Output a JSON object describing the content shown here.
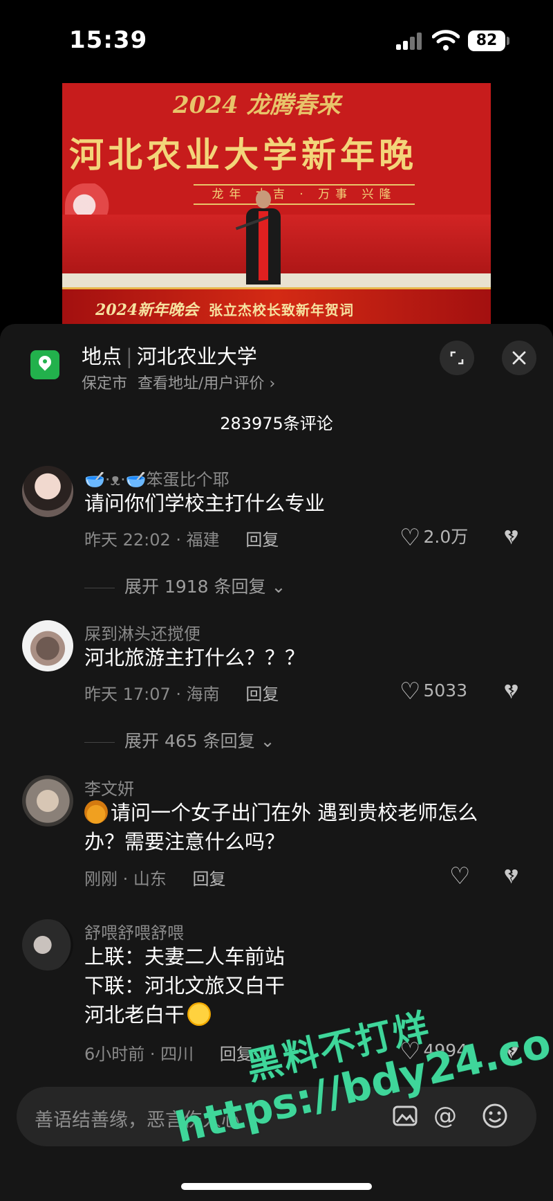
{
  "status_bar": {
    "time": "15:39",
    "battery": "82"
  },
  "video": {
    "top_gold_text": "2024 龙腾春来",
    "title": "河北农业大学新年晚",
    "sub_banner": "龙年 大吉 · 万事 兴隆",
    "caption_left": "2024新年晚会",
    "caption_right": "张立杰校长致新年贺词"
  },
  "location": {
    "label": "地点",
    "name": "河北农业大学",
    "city": "保定市",
    "link": "查看地址/用户评价",
    "chevron": "›"
  },
  "comment_count": "283975条评论",
  "comments": [
    {
      "user": "🥣·ᴥ·🥣笨蛋比个耶",
      "text": "请问你们学校主打什么专业",
      "time_place": "昨天 22:02 · 福建",
      "reply_label": "回复",
      "likes": "2.0万",
      "expand": "展开 1918 条回复"
    },
    {
      "user": "屎到淋头还搅便",
      "text": "河北旅游主打什么？？？",
      "time_place": "昨天 17:07 · 海南",
      "reply_label": "回复",
      "likes": "5033",
      "expand": "展开 465 条回复"
    },
    {
      "user": "李文妍",
      "text": "请问一个女子出门在外 遇到贵校老师怎么办？需要注意什么吗？",
      "time_place": "刚刚 · 山东",
      "reply_label": "回复",
      "likes": ""
    },
    {
      "user": "舒喂舒喂舒喂",
      "text_lines": [
        "上联：夫妻二人车前站",
        "下联：河北文旅又白干",
        "河北老白干"
      ],
      "time_place": "6小时前 · 四川",
      "reply_label": "回复",
      "likes": "4994"
    }
  ],
  "input": {
    "placeholder": "善语结善缘，恶言伤人心"
  },
  "icons": {
    "expand": "expand-icon",
    "close": "close-icon",
    "heart": "heart-icon",
    "dislike": "broken-heart-icon",
    "image": "image-icon",
    "at": "at-icon",
    "emoji": "emoji-icon"
  },
  "watermark": {
    "line1": "黑料不打烊",
    "line2": "https://bdy24.co"
  },
  "colors": {
    "location_green": "#22b14c",
    "sheet_bg": "#161616",
    "watermark_green": "#3fd69a"
  }
}
